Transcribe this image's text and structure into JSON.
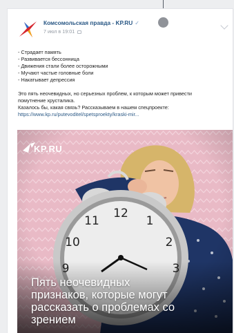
{
  "post": {
    "author": "Комсомольская правда - KP.RU",
    "verified_mark": "✓",
    "date": "7 июл в 19:01",
    "text_lines": [
      "- Страдает память",
      "- Развивается бессонница",
      "- Движения стали более осторожными",
      "- Мучают частые головные боли",
      "- Накатывает депрессия"
    ],
    "paragraph_lines": [
      "Это пять неочевидных, но серьезных проблем, к которым может привести",
      "помутнение хрусталика.",
      "Казалось бы, какая связь? Рассказываем в нашем спецпроекте:"
    ],
    "link": "https://www.kp.ru/putevoditel/spetsproekty/kraski-mir..."
  },
  "image": {
    "brand": "KP.RU",
    "caption_lines": [
      "Пять неочевидных",
      "признаков, которые могут",
      "рассказать о проблемах со",
      "зрением"
    ],
    "clock_numbers": [
      "12",
      "11",
      "1",
      "10",
      "2",
      "9",
      "3"
    ]
  },
  "colors": {
    "link": "#2a5885",
    "background_pink": "#e8b7c3"
  }
}
